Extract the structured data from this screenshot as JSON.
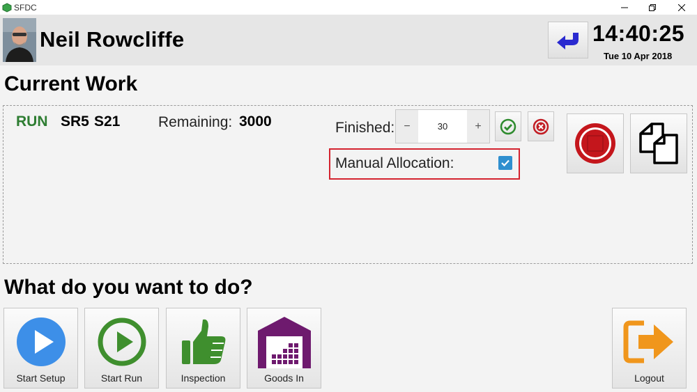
{
  "window": {
    "title": "SFDC"
  },
  "header": {
    "user_name": "Neil Rowcliffe",
    "time": "14:40:25",
    "date": "Tue 10 Apr 2018"
  },
  "current_work": {
    "heading": "Current Work",
    "status": "RUN",
    "code1": "SR5",
    "code2": "S21",
    "remaining_label": "Remaining:",
    "remaining_value": "3000",
    "finished_label": "Finished:",
    "finished_value": "30",
    "minus_label": "−",
    "plus_label": "+",
    "manual_allocation_label": "Manual Allocation:",
    "manual_allocation_checked": true
  },
  "actions": {
    "heading": "What do you want to do?",
    "items": [
      {
        "label": "Start Setup",
        "icon": "play-circle-icon"
      },
      {
        "label": "Start Run",
        "icon": "play-outline-icon"
      },
      {
        "label": "Inspection",
        "icon": "thumbs-up-icon"
      },
      {
        "label": "Goods In",
        "icon": "warehouse-icon"
      }
    ],
    "logout_label": "Logout"
  },
  "colors": {
    "run_green": "#2e7d32",
    "checkbox_blue": "#2f8fcf",
    "highlight_red": "#d4232f",
    "start_setup_blue": "#3d8fe8",
    "inspection_green": "#3f8f2e",
    "goods_in_purple": "#6e1a6e",
    "logout_orange": "#f0961c"
  }
}
